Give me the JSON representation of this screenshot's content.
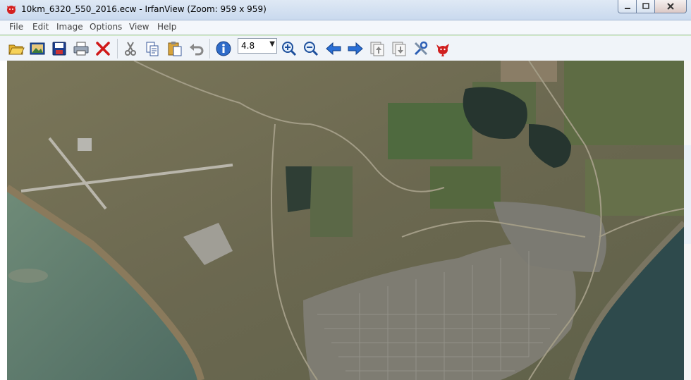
{
  "window": {
    "title": "10km_6320_550_2016.ecw - IrfanView (Zoom: 959 x 959)",
    "app_icon": "irfanview-cat-icon",
    "caption_buttons": {
      "minimize": "minimize-icon",
      "maximize": "maximize-icon",
      "close": "close-icon"
    }
  },
  "menu": {
    "items": [
      "File",
      "Edit",
      "Image",
      "Options",
      "View",
      "Help"
    ]
  },
  "toolbar": {
    "zoom_value": "4.8",
    "tools": [
      "open-folder-icon",
      "slideshow-icon",
      "save-icon",
      "print-icon",
      "delete-icon",
      "cut-icon",
      "copy-icon",
      "paste-icon",
      "undo-icon",
      "info-icon",
      "zoom-in-icon",
      "zoom-out-icon",
      "previous-icon",
      "next-icon",
      "page-up-icon",
      "page-down-icon",
      "settings-tools-icon",
      "irfanview-cat-icon"
    ]
  },
  "colors": {
    "sea": "#5a7a6e",
    "land": "#6e6b52",
    "fields": "#5d6b45",
    "lakes": "#2c3a33"
  }
}
